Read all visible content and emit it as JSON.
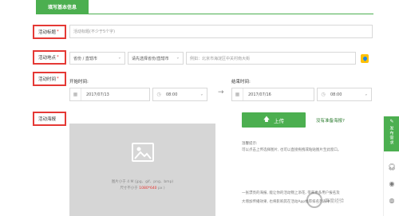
{
  "section": {
    "tab_label": "填写基本信息"
  },
  "fields": {
    "title_label": "活动标题",
    "title_required": "*",
    "title_placeholder": "活动标题(不少于5个字)",
    "location_label": "活动地点",
    "location_required": "*",
    "province_select": "省份 / 直辖市",
    "city_select": "请先选择省份/直辖市",
    "address_placeholder": "例如：北京市海淀区中关村南大街",
    "time_label": "活动时间",
    "time_required": "*",
    "start_time_label": "开始时间:",
    "end_time_label": "结束时间:",
    "start_date": "2017/07/13",
    "start_time": "08:00",
    "end_date": "2017/07/16",
    "end_time": "08:00",
    "arrow": "→",
    "poster_label": "活动海报"
  },
  "poster": {
    "hint_line1": "图片小于 4 M (jpg、gif、png、bmp)",
    "hint_line2_prefix": "尺寸不小于 ",
    "hint_line2_size": "1080*640",
    "hint_line2_suffix": " px )",
    "upload_label": "上传",
    "no_poster_link": "没有准备海报?",
    "tips_title": "温馨提示:",
    "tips_line1": "可以点击上传选择图片, 也可以直接拖拽或粘贴图片至此窗口。",
    "tips_line2": "一张漂亮的海报, 能让你的活动锦上添花, 带来更多用户报名及",
    "tips_line3": "大增加传播效果, 也将影响其在活动App推荐排名列表中"
  },
  "sidebar": {
    "publish_label": "发布需求",
    "icons": [
      "pen-icon",
      "headset-icon",
      "compass-icon",
      "weibo-icon"
    ]
  },
  "watermark": {
    "text": "百度经验"
  },
  "colors": {
    "accent": "#4caf50",
    "highlight": "#e53935"
  }
}
